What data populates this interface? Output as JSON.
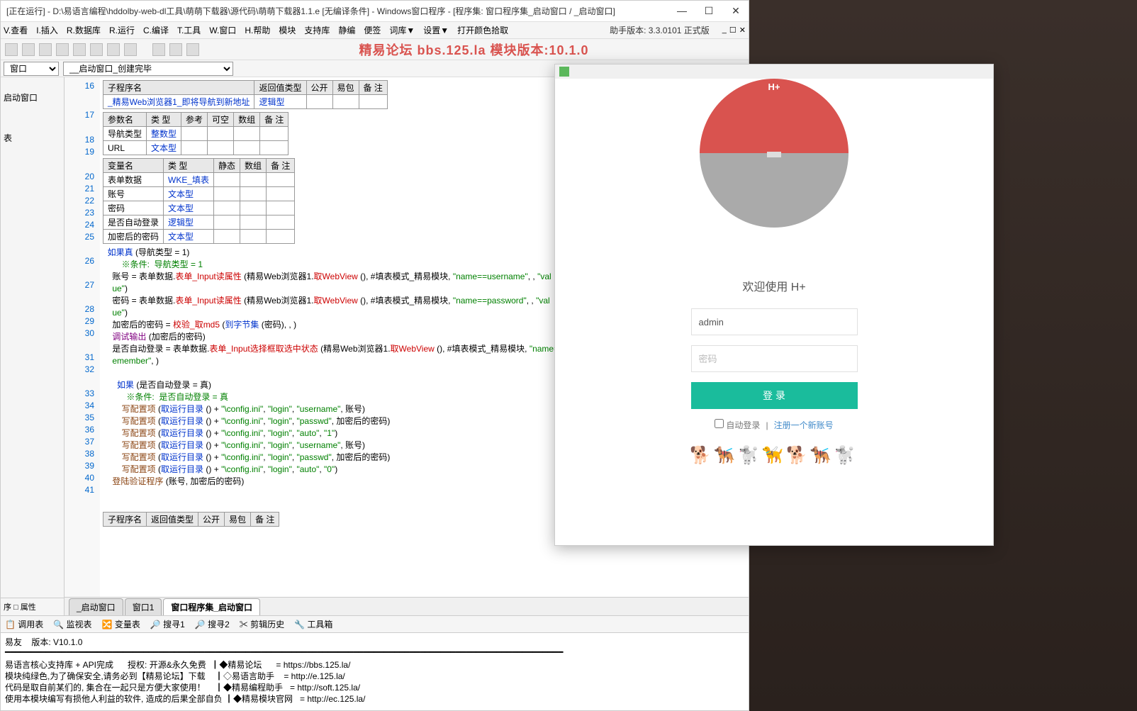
{
  "titlebar": "[正在运行] - D:\\易语言编程\\hddolby-web-dl工具\\萌萌下载器\\源代码\\萌萌下载器1.1.e [无编译条件] - Windows窗口程序 - [程序集: 窗口程序集_启动窗口 / _启动窗口]",
  "menu": [
    "V.查看",
    "I.插入",
    "R.数据库",
    "R.运行",
    "C.编译",
    "T.工具",
    "W.窗口",
    "H.帮助",
    "模块",
    "支持库",
    "静编",
    "便签",
    "词库▼",
    "设置▼",
    "打开颜色拾取"
  ],
  "helper_version": "助手版本: 3.3.0101 正式版",
  "banner": "精易论坛 bbs.125.la 模块版本:10.1.0",
  "combo1": "窗口",
  "combo2": "__启动窗口_创建完毕",
  "left_tree": [
    "",
    "启动窗口",
    "",
    "",
    "表"
  ],
  "left_tabs": "序  □ 属性",
  "sub_table": {
    "headers": [
      "子程序名",
      "返回值类型",
      "公开",
      "易包",
      "备 注"
    ],
    "row": [
      "_精易Web浏览器1_即将导航到新地址",
      "逻辑型",
      "",
      "",
      ""
    ]
  },
  "param_table": {
    "headers": [
      "参数名",
      "类 型",
      "参考",
      "可空",
      "数组",
      "备 注"
    ],
    "rows": [
      [
        "导航类型",
        "整数型",
        "",
        "",
        "",
        ""
      ],
      [
        "URL",
        "文本型",
        "",
        "",
        "",
        ""
      ]
    ]
  },
  "var_table": {
    "headers": [
      "变量名",
      "类 型",
      "静态",
      "数组",
      "备 注"
    ],
    "rows": [
      [
        "表单数据",
        "WKE_填表",
        "",
        "",
        ""
      ],
      [
        "账号",
        "文本型",
        "",
        "",
        ""
      ],
      [
        "密码",
        "文本型",
        "",
        "",
        ""
      ],
      [
        "是否自动登录",
        "逻辑型",
        "",
        "",
        ""
      ],
      [
        "加密后的密码",
        "文本型",
        "",
        "",
        ""
      ]
    ]
  },
  "code_lines": {
    "l25a": "如果真 (导航类型 = 1)",
    "l25b": "    ※条件:  导航类型 = 1",
    "l26": "账号 = 表单数据.表单_Input读属性 (精易Web浏览器1.取WebView (), #填表模式_精易模块, \"name==username\", , \"value\")",
    "l27": "密码 = 表单数据.表单_Input读属性 (精易Web浏览器1.取WebView (), #填表模式_精易模块, \"name==password\", , \"value\")",
    "l28": "加密后的密码 = 校验_取md5 (到字节集 (密码), , )",
    "l29": "调试输出 (加密后的密码)",
    "l30": "是否自动登录 = 表单数据.表单_Input选择框取选中状态 (精易Web浏览器1.取WebView (), #填表模式_精易模块, \"name==remember\", )",
    "l32a": "如果 (是否自动登录 = 真)",
    "l32b": "    ※条件:  是否自动登录 = 真",
    "l33": "写配置项 (取运行目录 () + \"\\config.ini\", \"login\", \"username\", 账号)",
    "l34": "写配置项 (取运行目录 () + \"\\config.ini\", \"login\", \"passwd\", 加密后的密码)",
    "l35": "写配置项 (取运行目录 () + \"\\config.ini\", \"login\", \"auto\", \"1\")",
    "l36": "写配置项 (取运行目录 () + \"\\config.ini\", \"login\", \"username\", 账号)",
    "l37": "写配置项 (取运行目录 () + \"\\config.ini\", \"login\", \"passwd\", 加密后的密码)",
    "l38": "写配置项 (取运行目录 () + \"\\config.ini\", \"login\", \"auto\", \"0\")",
    "l39": "登陆验证程序 (账号, 加密后的密码)"
  },
  "sub_table2_headers": [
    "子程序名",
    "返回值类型",
    "公开",
    "易包",
    "备 注"
  ],
  "bottom_tabs": [
    "_启动窗口",
    "窗口1",
    "窗口程序集_启动窗口"
  ],
  "lower_tabs": [
    "📋 调用表",
    "🔍 监视表",
    "🔀 变量表",
    "🔎 搜寻1",
    "🔎 搜寻2",
    "✂ 剪辑历史",
    "🔧 工具箱"
  ],
  "console": {
    "l1": "易友    版本: V10.1.0",
    "l2": "━━━━━━━━━━━━━━━━━━━━━━━━━━━━━━━━━━━━━━━━━━━━━━━━━━━━━━━━━━━━━━━━━━━━━━━━━━━━━━━━━━━━━━━━━━━━━━━━━━━━━━━━━━━━━",
    "l3": "易语言核心支持库 + API完成      授权: 开源&永久免费  ┃◆精易论坛      = https://bbs.125.la/",
    "l4": "模块纯绿色,为了确保安全,请务必到【精易论坛】下载    ┃◇易语言助手    = http://e.125.la/",
    "l5": "代码是取自前某们的, 集合在一起只是方便大家使用！    ┃◆精易编程助手   = http://soft.125.la/",
    "l6": "使用本模块编写有损他人利益的软件, 造成的后果全部自负 ┃◆精易模块官网   = http://ec.125.la/"
  },
  "login": {
    "brand": "H+",
    "welcome": "欢迎使用 H+",
    "username_value": "admin",
    "password_placeholder": "密码",
    "button": "登 录",
    "auto_label": "自动登录",
    "sep": "|",
    "register": "注册一个新账号"
  }
}
